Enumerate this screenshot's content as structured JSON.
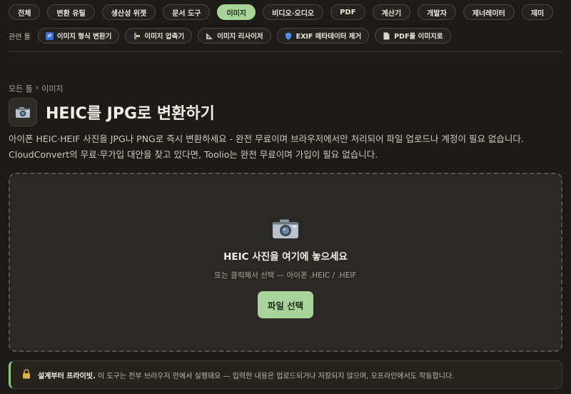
{
  "categories": [
    {
      "label": "전체",
      "active": false
    },
    {
      "label": "변환 유틸",
      "active": false
    },
    {
      "label": "생산성 위젯",
      "active": false
    },
    {
      "label": "문서 도구",
      "active": false
    },
    {
      "label": "이미지",
      "active": true
    },
    {
      "label": "비디오·오디오",
      "active": false
    },
    {
      "label": "PDF",
      "active": false
    },
    {
      "label": "계산기",
      "active": false
    },
    {
      "label": "개발자",
      "active": false
    },
    {
      "label": "제너레이터",
      "active": false
    },
    {
      "label": "재미",
      "active": false
    }
  ],
  "related": {
    "label": "관련 툴",
    "items": [
      {
        "label": "이미지 형식 변환기",
        "icon": "convert-icon"
      },
      {
        "label": "이미지 압축기",
        "icon": "clamp-icon"
      },
      {
        "label": "이미지 리사이저",
        "icon": "ruler-icon"
      },
      {
        "label": "EXIF 메타데이터 제거",
        "icon": "shield-icon"
      },
      {
        "label": "PDF를 이미지로",
        "icon": "document-icon"
      }
    ]
  },
  "breadcrumb": {
    "root": "모든 툴",
    "separator": "›",
    "current": "이미지"
  },
  "page": {
    "icon": "camera-icon",
    "title": "HEIC를 JPG로 변환하기",
    "description": "아이폰 HEIC·HEIF 사진을 JPG나 PNG로 즉시 변환하세요 - 완전 무료이며 브라우저에서만 처리되어 파일 업로드나 계정이 필요 없습니다. CloudConvert의 무료·무가입 대안을 찾고 있다면, Toolio는 완전 무료이며 가입이 필요 없습니다."
  },
  "dropzone": {
    "icon": "camera-icon",
    "title": "HEIC 사진을 여기에 놓으세요",
    "subtitle": "또는 클릭해서 선택 — 아이폰 .HEIC / .HEIF",
    "button_label": "파일 선택"
  },
  "privacy": {
    "icon": "lock-icon",
    "strong": "설계부터 프라이빗.",
    "text": "이 도구는 전부 브라우저 안에서 실행돼요 — 입력한 내용은 업로드되거나 저장되지 않으며, 오프라인에서도 작동합니다."
  },
  "colors": {
    "background": "#1c1b18",
    "accent": "#a8d49a",
    "dropzone_bg": "#2a2824"
  }
}
